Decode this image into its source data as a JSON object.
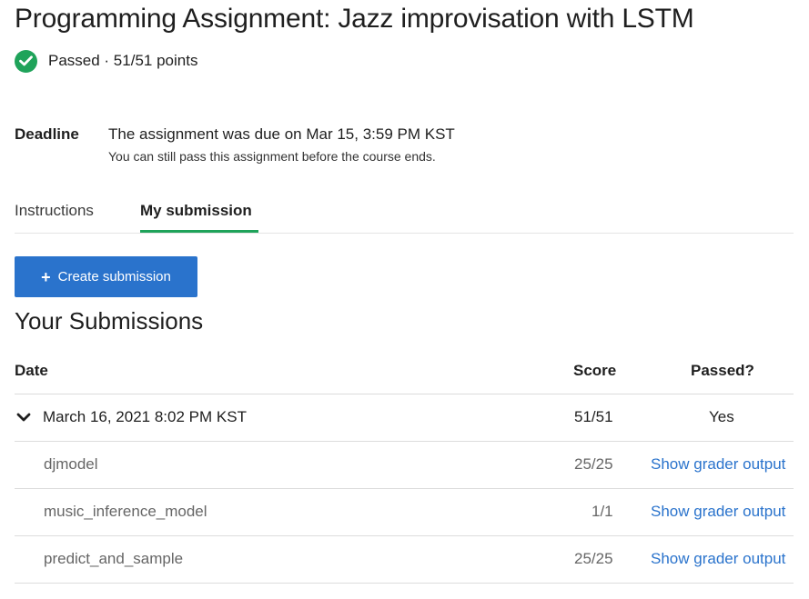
{
  "page": {
    "title": "Programming Assignment: Jazz improvisation with LSTM",
    "status": "Passed · 51/51 points"
  },
  "deadline": {
    "label": "Deadline",
    "main": "The assignment was due on Mar 15, 3:59 PM KST",
    "sub": "You can still pass this assignment before the course ends."
  },
  "tabs": [
    {
      "label": "Instructions",
      "active": false
    },
    {
      "label": "My submission",
      "active": true
    }
  ],
  "create_button": {
    "label": "Create submission",
    "icon": "plus-icon"
  },
  "submissions": {
    "title": "Your Submissions",
    "columns": {
      "date": "Date",
      "score": "Score",
      "passed": "Passed?"
    },
    "entry": {
      "date": "March 16, 2021 8:02 PM KST",
      "score": "51/51",
      "passed": "Yes",
      "expanded": true,
      "parts": [
        {
          "name": "djmodel",
          "score": "25/25",
          "action": "Show grader output"
        },
        {
          "name": "music_inference_model",
          "score": "1/1",
          "action": "Show grader output"
        },
        {
          "name": "predict_and_sample",
          "score": "25/25",
          "action": "Show grader output"
        }
      ]
    }
  },
  "colors": {
    "accent_green": "#1fa35a",
    "primary_blue": "#2a73cc",
    "text": "#1f1f1f",
    "muted": "#666666",
    "divider": "#dcdcdc"
  }
}
